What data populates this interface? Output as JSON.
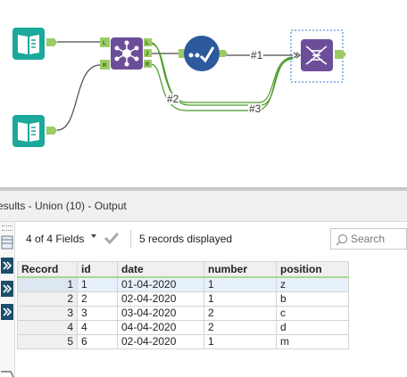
{
  "canvas": {
    "connections": [
      {
        "label": "#1"
      },
      {
        "label": "#2"
      },
      {
        "label": "#3"
      }
    ],
    "anchors": {
      "left": "L",
      "join": "J",
      "right": "R",
      "input_left": "L",
      "input_right": "R"
    },
    "colors": {
      "input_tool": "#1aa99a",
      "join_tool": "#6c4e98",
      "select_tool": "#2c5a9c",
      "union_tool": "#6c4e98",
      "connector": "#9ccc65",
      "wire": "#4a4a4a",
      "wire_highlight": "#4c9a2a"
    },
    "icons": [
      "book-input-icon",
      "join-icon",
      "select-check-icon",
      "union-dna-icon"
    ]
  },
  "results": {
    "title": "esults - Union (10) - Output",
    "fields_label": "4 of 4 Fields",
    "records_label": "5 records displayed",
    "search_placeholder": "Search",
    "columns": [
      "Record",
      "id",
      "date",
      "number",
      "position"
    ],
    "rows": [
      {
        "record": "1",
        "id": "1",
        "date": "01-04-2020",
        "number": "1",
        "position": "z"
      },
      {
        "record": "2",
        "id": "2",
        "date": "02-04-2020",
        "number": "1",
        "position": "b"
      },
      {
        "record": "3",
        "id": "3",
        "date": "03-04-2020",
        "number": "2",
        "position": "c"
      },
      {
        "record": "4",
        "id": "4",
        "date": "04-04-2020",
        "number": "2",
        "position": "d"
      },
      {
        "record": "5",
        "id": "6",
        "date": "02-04-2020",
        "number": "1",
        "position": "m"
      }
    ]
  }
}
